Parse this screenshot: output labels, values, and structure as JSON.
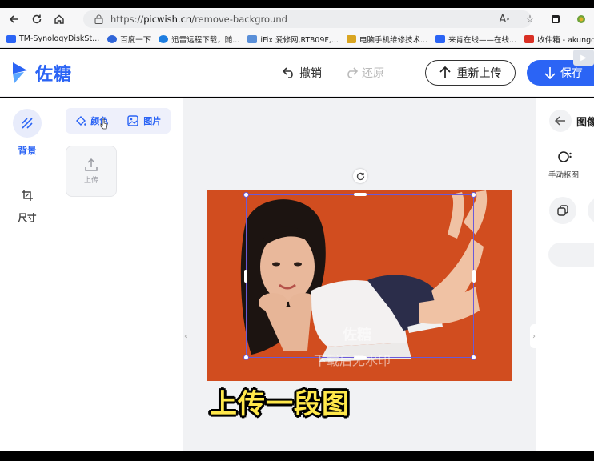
{
  "browser": {
    "url_scheme": "https://",
    "url_host": "picwish.cn",
    "url_path": "/remove-background",
    "bookmarks": [
      {
        "label": "TM-SynologyDiskSt...",
        "color": "#2b64f5"
      },
      {
        "label": "百度一下",
        "color": "#3065d8"
      },
      {
        "label": "迅雷远程下载，随...",
        "color": "#1d7de0"
      },
      {
        "label": "iFix 爱修网,RT809F,...",
        "color": "#5a8fd8"
      },
      {
        "label": "电脑手机维修技术...",
        "color": "#d9a521"
      },
      {
        "label": "来肯在线——在线...",
        "color": "#2b64f5"
      },
      {
        "label": "收件箱 - akungogo...",
        "color": "#d93025"
      }
    ]
  },
  "header": {
    "logo_text": "佐糖",
    "undo_label": "撤销",
    "redo_label": "还原",
    "reupload_label": "重新上传",
    "save_label": "保存"
  },
  "left_rail": {
    "background_label": "背景",
    "size_label": "尺寸"
  },
  "panel": {
    "tab_color_label": "颜色",
    "tab_image_label": "图片",
    "upload_label": "上传"
  },
  "canvas": {
    "background_color": "#d14d1f",
    "watermark_brand": "佐糖",
    "watermark_note": "下载后无水印",
    "caption": "上传一段图"
  },
  "right_panel": {
    "title": "图像",
    "manual_cutout_label": "手动抠图"
  },
  "colors": {
    "accent": "#2b64f5",
    "selection": "#6a5ad9"
  }
}
